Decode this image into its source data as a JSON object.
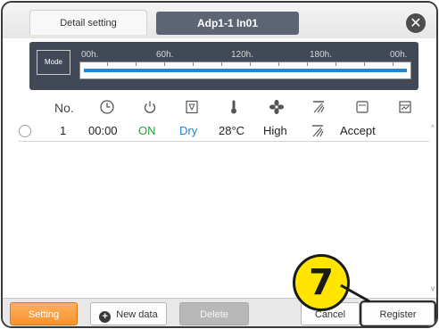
{
  "header": {
    "tab_label": "Detail setting",
    "title": "Adp1-1 In01",
    "close_symbol": "✕"
  },
  "timeline": {
    "mode_label": "Mode",
    "ticks": [
      "00h.",
      "60h.",
      "120h.",
      "180h.",
      "00h."
    ]
  },
  "columns": {
    "no_label": "No.",
    "icons": [
      "clock-icon",
      "power-icon",
      "mode-icon",
      "thermometer-icon",
      "fan-icon",
      "louver-icon",
      "filter-icon",
      "permission-icon"
    ]
  },
  "rows": [
    {
      "no": "1",
      "time": "00:00",
      "power": "ON",
      "mode": "Dry",
      "temp": "28°C",
      "fan": "High",
      "permission": "Accept"
    }
  ],
  "colors": {
    "power_on": "#2e9b3a",
    "mode_dry": "#2286d1",
    "accent_orange": "#f59330",
    "callout_yellow": "#ffe500"
  },
  "footer": {
    "setting_label": "Setting",
    "new_data_label": "New data",
    "delete_label": "Delete",
    "cancel_label": "Cancel",
    "register_label": "Register"
  },
  "callout": {
    "number": "7"
  }
}
